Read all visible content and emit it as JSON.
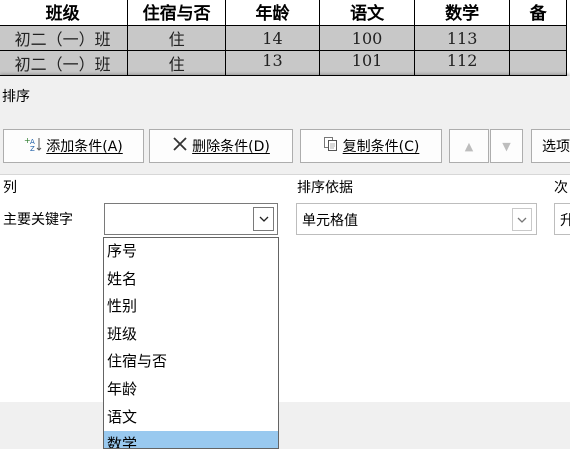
{
  "sheet": {
    "headers": [
      "班级",
      "住宿与否",
      "年龄",
      "语文",
      "数学",
      "备"
    ],
    "rows": [
      [
        "初二（一）班",
        "住",
        "14",
        "100",
        "113",
        ""
      ],
      [
        "初二（一）班",
        "住",
        "13",
        "101",
        "112",
        ""
      ]
    ]
  },
  "dialog": {
    "title": "排序",
    "toolbar": {
      "add_label": "添加条件(A)",
      "delete_label": "删除条件(D)",
      "copy_label": "复制条件(C)",
      "options_label": "选项"
    },
    "columns": {
      "col_header": "列",
      "basis_header": "排序依据",
      "order_header": "次"
    },
    "row": {
      "key_label": "主要关键字",
      "column_value": "",
      "basis_value": "单元格值",
      "order_value": "升"
    },
    "column_options": [
      "序号",
      "姓名",
      "性别",
      "班级",
      "住宿与否",
      "年龄",
      "语文",
      "数学"
    ],
    "highlighted_option": "数学"
  }
}
